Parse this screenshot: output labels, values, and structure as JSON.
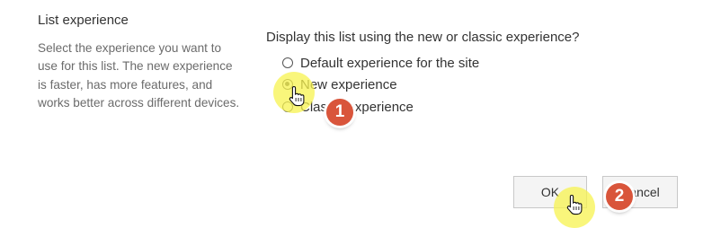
{
  "section": {
    "title": "List experience",
    "description": "Select the experience you want to use for this list. The new experience is faster, has more features, and works better across different devices."
  },
  "question": "Display this list using the new or classic experience?",
  "options": [
    {
      "label": "Default experience for the site",
      "checked": false
    },
    {
      "label": "New experience",
      "checked": true
    },
    {
      "label": "Classic experience",
      "checked": false
    }
  ],
  "buttons": {
    "ok_label": "OK",
    "cancel_label": "Cancel"
  },
  "callouts": [
    {
      "number": "1"
    },
    {
      "number": "2"
    }
  ],
  "colors": {
    "highlight": "#f7f34f",
    "badge": "#d9553b"
  },
  "icons": {
    "cursor": "hand-pointer-icon"
  }
}
